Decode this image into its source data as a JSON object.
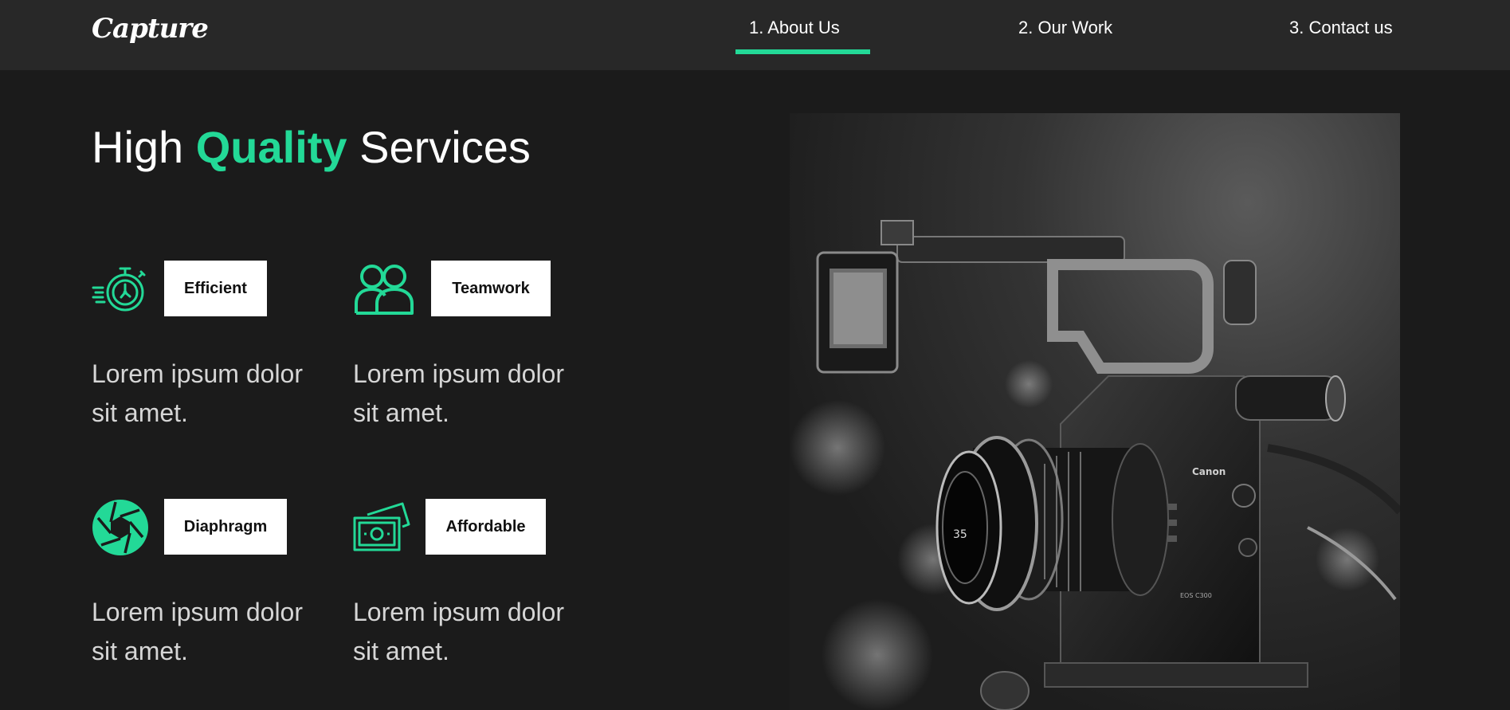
{
  "header": {
    "logo": "Capture",
    "nav": [
      {
        "label": "1. About Us",
        "active": true
      },
      {
        "label": "2. Our Work",
        "active": false
      },
      {
        "label": "3. Contact us",
        "active": false
      }
    ]
  },
  "hero": {
    "title_pre": "High ",
    "title_accent": "Quality",
    "title_post": " Services"
  },
  "services": [
    {
      "icon": "stopwatch-icon",
      "label": "Efficient",
      "description": "Lorem ipsum dolor sit amet."
    },
    {
      "icon": "team-icon",
      "label": "Teamwork",
      "description": "Lorem ipsum dolor sit amet."
    },
    {
      "icon": "aperture-icon",
      "label": "Diaphragm",
      "description": "Lorem ipsum dolor sit amet."
    },
    {
      "icon": "money-icon",
      "label": "Affordable",
      "description": "Lorem ipsum dolor sit amet."
    }
  ],
  "camera_image": {
    "subject": "black and white cinema camera",
    "brand_text": "Canon",
    "model_text": "EOS C300",
    "lens_mark": "35"
  },
  "colors": {
    "accent": "#23d997",
    "background": "#1b1b1b",
    "header": "#282828"
  }
}
